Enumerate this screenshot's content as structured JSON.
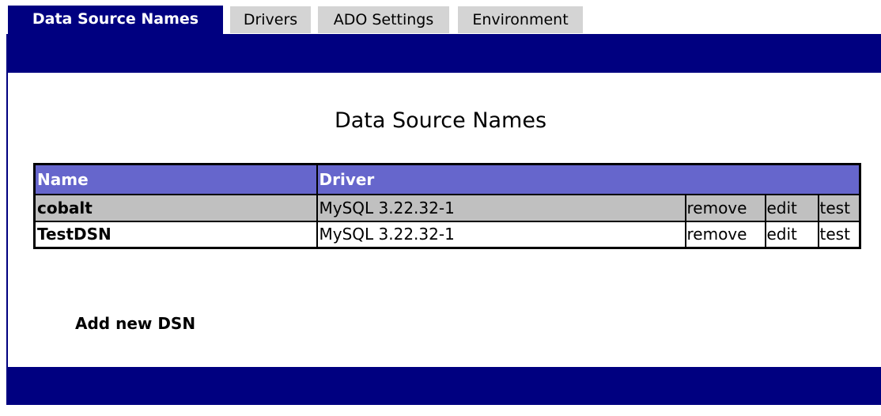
{
  "tabs": [
    {
      "label": "Data Source Names",
      "active": true
    },
    {
      "label": "Drivers",
      "active": false
    },
    {
      "label": "ADO Settings",
      "active": false
    },
    {
      "label": "Environment",
      "active": false
    }
  ],
  "page": {
    "title": "Data Source Names",
    "add_link": "Add new DSN"
  },
  "table": {
    "headers": {
      "name": "Name",
      "driver": "Driver"
    },
    "rows": [
      {
        "name": "cobalt",
        "driver": "MySQL 3.22.32-1",
        "remove": "remove",
        "edit": "edit",
        "test": "test"
      },
      {
        "name": "TestDSN",
        "driver": "MySQL 3.22.32-1",
        "remove": "remove",
        "edit": "edit",
        "test": "test"
      }
    ]
  },
  "colors": {
    "navy": "#000080",
    "header_bg": "#6666cc",
    "shaded_row": "#c0c0c0",
    "inactive_tab": "#d4d4d4"
  }
}
